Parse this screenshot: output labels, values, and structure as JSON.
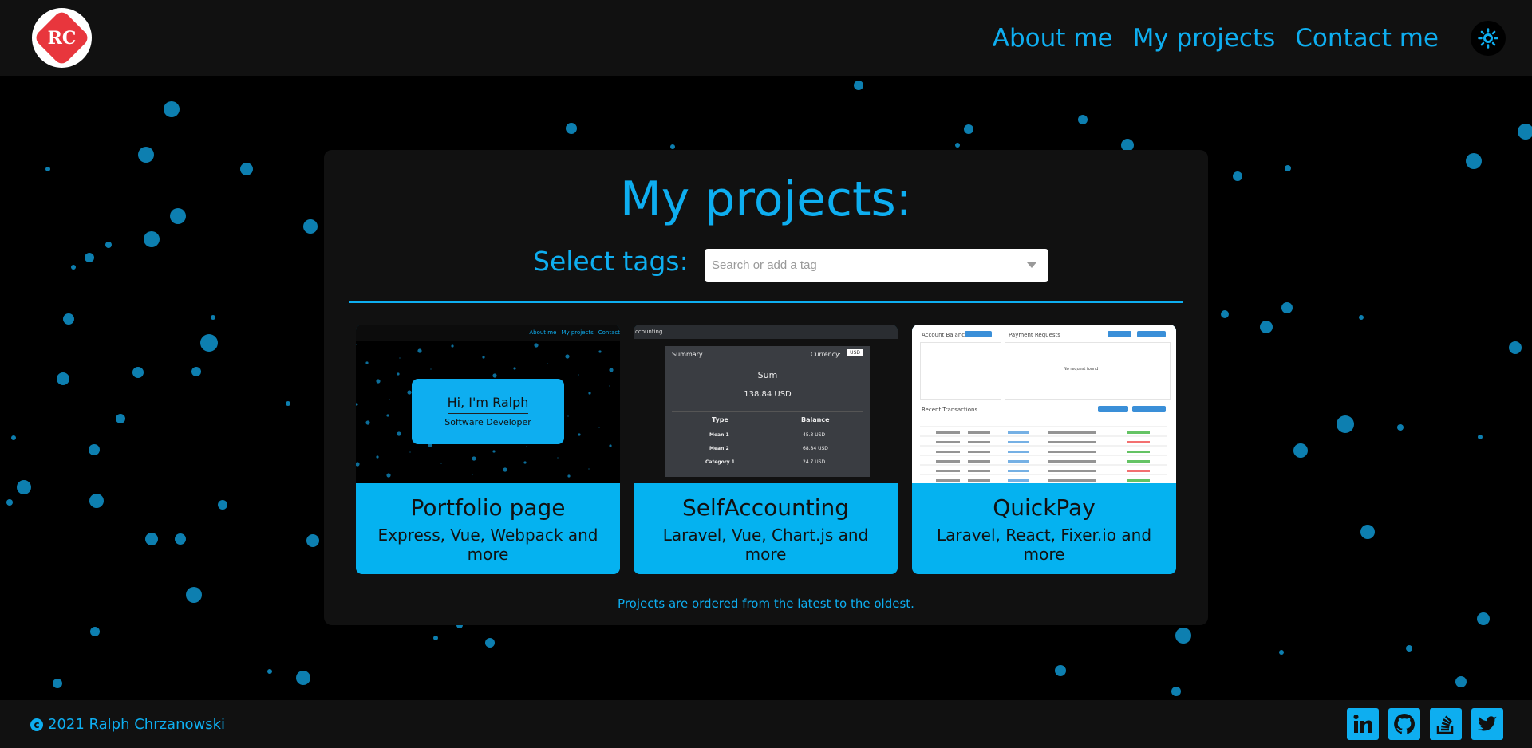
{
  "header": {
    "logo_text": "RC",
    "nav": [
      {
        "label": "About me"
      },
      {
        "label": "My projects"
      },
      {
        "label": "Contact me"
      }
    ],
    "theme_toggle_icon": "sun-icon"
  },
  "main": {
    "title": "My projects:",
    "tags_label": "Select tags:",
    "tags_placeholder": "Search or add a tag",
    "projects": [
      {
        "title": "Portfolio page",
        "techs": "Express, Vue, Webpack and more",
        "preview": {
          "nav": [
            "About me",
            "My projects",
            "Contact"
          ],
          "greeting": "Hi, I'm Ralph",
          "subtitle": "Software Developer"
        }
      },
      {
        "title": "SelfAccounting",
        "techs": "Laravel, Vue, Chart.js and more",
        "preview": {
          "bar": "ccounting",
          "summary": "Summary",
          "currency_label": "Currency:",
          "currency": "USD",
          "sum_label": "Sum",
          "sum": "138.84 USD",
          "col_type": "Type",
          "col_balance": "Balance",
          "rows": [
            [
              "Mean 1",
              "45.3 USD"
            ],
            [
              "Mean 2",
              "68.84 USD"
            ],
            [
              "Category 1",
              "24.7 USD"
            ]
          ]
        }
      },
      {
        "title": "QuickPay",
        "techs": "Laravel, React, Fixer.io and more",
        "preview": {
          "account_balance": "Account Balance",
          "payment_requests": "Payment Requests",
          "recent_transactions": "Recent Transactions",
          "no_requests": "No request found"
        }
      }
    ],
    "order_note": "Projects are ordered from the latest to the oldest."
  },
  "footer": {
    "copyright_symbol": "c",
    "copyright": "2021 Ralph Chrzanowski",
    "socials": [
      {
        "icon": "linkedin-icon"
      },
      {
        "icon": "github-icon"
      },
      {
        "icon": "stackoverflow-icon"
      },
      {
        "icon": "twitter-icon"
      }
    ]
  },
  "colors": {
    "accent": "#0eaef0",
    "card": "#05b2f0",
    "panel": "#111111",
    "background": "#000000",
    "logo_red": "#e8363d"
  }
}
